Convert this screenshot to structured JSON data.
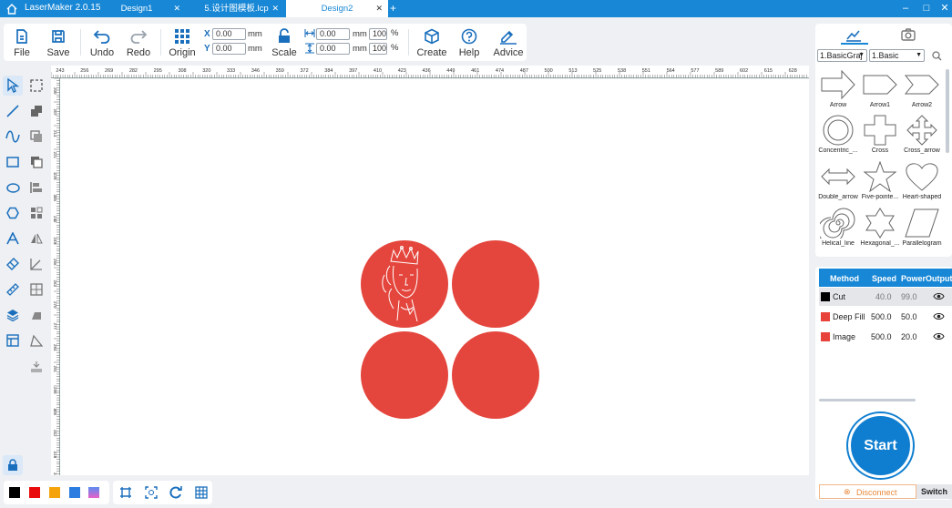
{
  "app": {
    "name": "LaserMaker 2.0.15"
  },
  "tabs": [
    {
      "label": "Design1"
    },
    {
      "label": "5.设计图模板.lcp"
    },
    {
      "label": "Design2"
    }
  ],
  "window": {
    "minimize": "–",
    "maximize": "□",
    "close": "✕"
  },
  "toolbar": {
    "file": "File",
    "save": "Save",
    "undo": "Undo",
    "redo": "Redo",
    "origin": "Origin",
    "x_label": "X",
    "y_label": "Y",
    "x_value": "0.00",
    "y_value": "0.00",
    "unit": "mm",
    "w_value": "0.00",
    "h_value": "0.00",
    "w_pct": "100",
    "h_pct": "100",
    "pct": "%",
    "scale": "Scale",
    "create": "Create",
    "help": "Help",
    "advice": "Advice"
  },
  "ruler": {
    "top": [
      "243",
      "256",
      "269",
      "282",
      "295",
      "308",
      "320",
      "333",
      "346",
      "359",
      "372",
      "384",
      "397",
      "410",
      "423",
      "436",
      "449",
      "461",
      "474",
      "487",
      "500",
      "513",
      "525",
      "538",
      "551",
      "564",
      "577",
      "589",
      "602",
      "615",
      "628"
    ],
    "left": [
      "200",
      "207",
      "214",
      "221",
      "228",
      "235",
      "242",
      "249",
      "256",
      "263",
      "270",
      "277",
      "284",
      "291",
      "298",
      "305",
      "312",
      "319",
      "326"
    ]
  },
  "library": {
    "category": "1.BasicGraj",
    "subcategory": "1.Basic",
    "shapes": [
      {
        "label": "Arrow",
        "icon": "arrow-shape"
      },
      {
        "label": "Arrow1",
        "icon": "arrow1-shape"
      },
      {
        "label": "Arrow2",
        "icon": "arrow2-shape"
      },
      {
        "label": "Concentric_...",
        "icon": "concentric-shape"
      },
      {
        "label": "Cross",
        "icon": "cross-shape"
      },
      {
        "label": "Cross_arrow",
        "icon": "cross-arrow-shape"
      },
      {
        "label": "Double_arrow",
        "icon": "double-arrow-shape"
      },
      {
        "label": "Five-pointe...",
        "icon": "star-shape"
      },
      {
        "label": "Heart-shaped",
        "icon": "heart-shape"
      },
      {
        "label": "Helical_line",
        "icon": "spiral-shape"
      },
      {
        "label": "Hexagonal_...",
        "icon": "hexagram-shape"
      },
      {
        "label": "Parallelogram",
        "icon": "parallelogram-shape"
      }
    ]
  },
  "layers": {
    "headers": {
      "method": "Method",
      "speed": "Speed",
      "power": "Power",
      "output": "Output"
    },
    "rows": [
      {
        "method": "Cut",
        "speed": "40.0",
        "power": "99.0",
        "color": "#000000"
      },
      {
        "method": "Deep Fill",
        "speed": "500.0",
        "power": "50.0",
        "color": "#e8433a"
      },
      {
        "method": "Image",
        "speed": "500.0",
        "power": "20.0",
        "color": "#e8433a"
      }
    ]
  },
  "device": {
    "start": "Start",
    "disconnect": "Disconnect",
    "switch": "Switch"
  },
  "palette": [
    "#000000",
    "#e80c0c",
    "#f5a30a",
    "#2b7de0",
    "#c86ad8"
  ],
  "colors": {
    "accent": "#1787d6",
    "circle": "#e4463d"
  }
}
